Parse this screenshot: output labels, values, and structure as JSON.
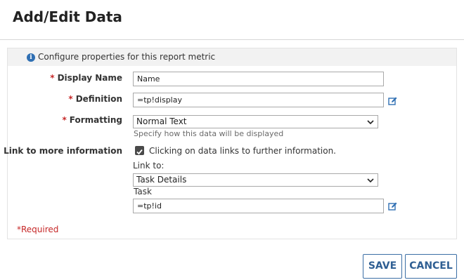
{
  "dialog": {
    "title": "Add/Edit Data"
  },
  "panel": {
    "info_text": "Configure properties for this report metric"
  },
  "form": {
    "required_marker": "*",
    "display_name": {
      "label": "Display Name",
      "value": "Name"
    },
    "definition": {
      "label": "Definition",
      "value": "=tp!display"
    },
    "formatting": {
      "label": "Formatting",
      "selected": "Normal Text",
      "hint": "Specify how this data will be displayed"
    },
    "link": {
      "label": "Link to more information",
      "checkbox_label": "Clicking on data links to further information.",
      "checked": true,
      "link_to_label": "Link to:",
      "link_to_selected": "Task Details",
      "task_label": "Task",
      "task_value": "=tp!id"
    },
    "required_note": "*Required"
  },
  "buttons": {
    "save": "SAVE",
    "cancel": "CANCEL"
  },
  "colors": {
    "accent": "#2f5f93",
    "required": "#c62828",
    "info": "#2f6fb3"
  }
}
